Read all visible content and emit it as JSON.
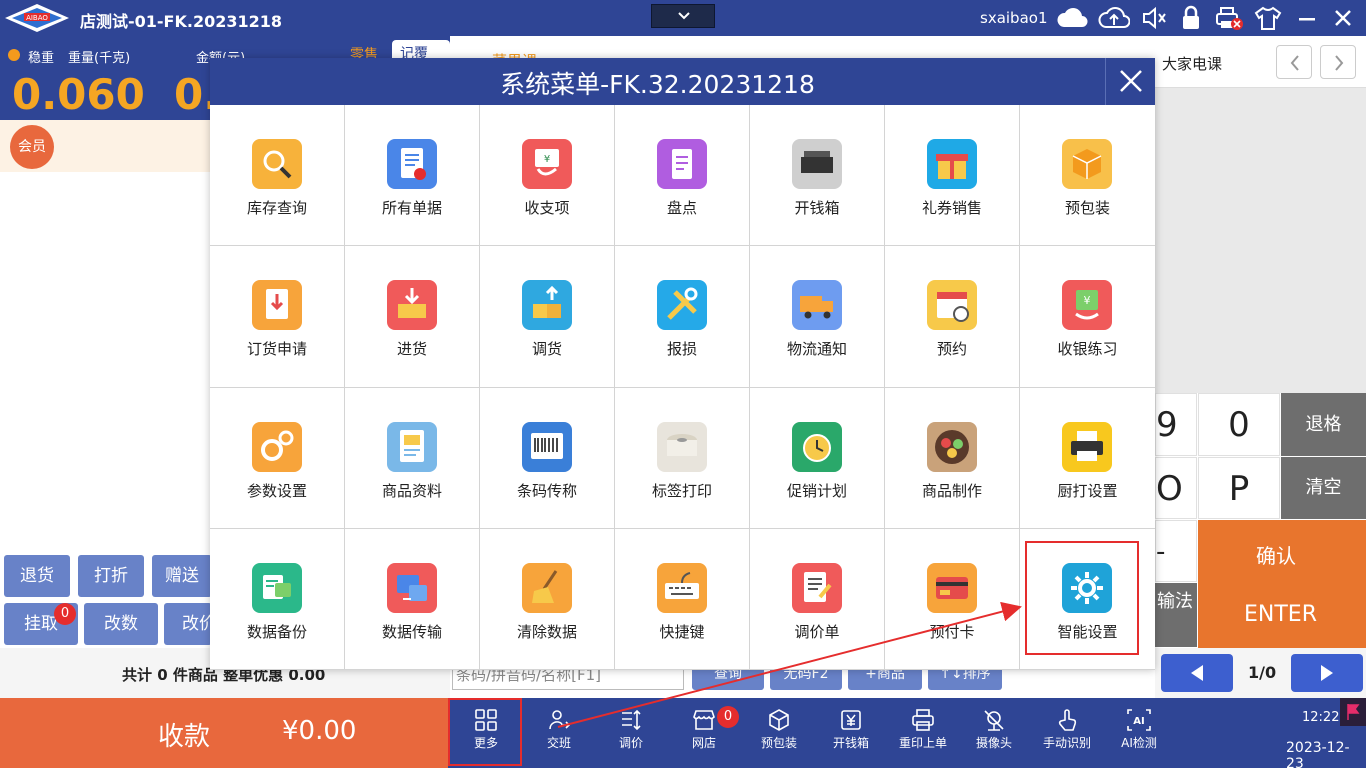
{
  "window": {
    "title": "店测试-01-FK.20231218",
    "logo_text": "AIBAO",
    "user": "sxaibao1"
  },
  "scale": {
    "stable_label": "稳重",
    "weight_label": "重量(千克)",
    "amount_label": "金额(元)",
    "weight_value": "0.060",
    "amount_value": "0.",
    "tabs": {
      "retail": "零售",
      "recall": "记覆"
    }
  },
  "member": {
    "label": "会员"
  },
  "actions": {
    "return": "退货",
    "discount": "打折",
    "gift": "赠送",
    "hold": "挂取",
    "hold_badge": "0",
    "change_qty": "改数",
    "change_price": "改价"
  },
  "summary": {
    "text": "共计 0 件商品 整单优惠 0.00"
  },
  "pay": {
    "label": "收款",
    "amount": "¥0.00"
  },
  "categories": {
    "partial_tab": "大家电课",
    "retail_partial": "菜果课"
  },
  "search": {
    "placeholder": "条码/拼音码/名称[F1]",
    "buttons": [
      "查询",
      "无码F2",
      "+商品",
      "↑↓排序"
    ]
  },
  "keypad": {
    "k9": "9",
    "k0": "0",
    "backspace": "退格",
    "kO": "O",
    "kP": "P",
    "clear": "清空",
    "dash": "-",
    "ime": "输法",
    "confirm": "确认",
    "enter": "ENTER"
  },
  "pager": {
    "text": "1/0"
  },
  "bottom_toolbar": [
    {
      "label": "更多",
      "icon": "grid-icon"
    },
    {
      "label": "交班",
      "icon": "user-switch-icon"
    },
    {
      "label": "调价",
      "icon": "sort-icon"
    },
    {
      "label": "网店",
      "icon": "store-icon",
      "badge": "0"
    },
    {
      "label": "预包装",
      "icon": "box-icon"
    },
    {
      "label": "开钱箱",
      "icon": "cashbox-icon"
    },
    {
      "label": "重印上单",
      "icon": "printer-icon"
    },
    {
      "label": "摄像头",
      "icon": "camera-off-icon"
    },
    {
      "label": "手动识别",
      "icon": "hand-pointer-icon"
    },
    {
      "label": "AI检测",
      "icon": "ai-icon"
    }
  ],
  "clock": {
    "time": "12:22",
    "date": "2023-12-23"
  },
  "modal": {
    "title": "系统菜单-FK.32.20231218",
    "items": [
      {
        "label": "库存查询",
        "icon": "inventory-search-icon",
        "color": "#f7b23b"
      },
      {
        "label": "所有单据",
        "icon": "documents-icon",
        "color": "#4a86e8"
      },
      {
        "label": "收支项",
        "icon": "income-expense-icon",
        "color": "#f05a5a"
      },
      {
        "label": "盘点",
        "icon": "stocktake-icon",
        "color": "#b05de0"
      },
      {
        "label": "开钱箱",
        "icon": "cash-drawer-icon",
        "color": "#cfcfcf"
      },
      {
        "label": "礼券销售",
        "icon": "gift-icon",
        "color": "#1fa9e6"
      },
      {
        "label": "预包装",
        "icon": "package-icon",
        "color": "#f8c04a"
      },
      {
        "label": "订货申请",
        "icon": "order-request-icon",
        "color": "#f7a43b"
      },
      {
        "label": "进货",
        "icon": "purchase-icon",
        "color": "#f05a5a"
      },
      {
        "label": "调货",
        "icon": "transfer-icon",
        "color": "#2fa8e0"
      },
      {
        "label": "报损",
        "icon": "tools-icon",
        "color": "#25a9e8"
      },
      {
        "label": "物流通知",
        "icon": "truck-icon",
        "color": "#6e9cf0"
      },
      {
        "label": "预约",
        "icon": "calendar-icon",
        "color": "#f7c94a"
      },
      {
        "label": "收银练习",
        "icon": "cash-practice-icon",
        "color": "#f05a5a"
      },
      {
        "label": "参数设置",
        "icon": "gears-icon",
        "color": "#f7a43b"
      },
      {
        "label": "商品资料",
        "icon": "product-file-icon",
        "color": "#7ab8e8"
      },
      {
        "label": "条码传称",
        "icon": "barcode-icon",
        "color": "#3a7fd8"
      },
      {
        "label": "标签打印",
        "icon": "label-roll-icon",
        "color": "#e8e4dc"
      },
      {
        "label": "促销计划",
        "icon": "alarm-clock-icon",
        "color": "#2aa86a"
      },
      {
        "label": "商品制作",
        "icon": "food-bowl-icon",
        "color": "#c9a27a"
      },
      {
        "label": "厨打设置",
        "icon": "kitchen-printer-icon",
        "color": "#f8c81e"
      },
      {
        "label": "数据备份",
        "icon": "backup-icon",
        "color": "#2bb88a"
      },
      {
        "label": "数据传输",
        "icon": "data-transfer-icon",
        "color": "#f05a5a"
      },
      {
        "label": "清除数据",
        "icon": "broom-icon",
        "color": "#f7a43b"
      },
      {
        "label": "快捷键",
        "icon": "keyboard-icon",
        "color": "#f7a43b"
      },
      {
        "label": "调价单",
        "icon": "price-sheet-icon",
        "color": "#f05a5a"
      },
      {
        "label": "预付卡",
        "icon": "prepaid-card-icon",
        "color": "#f7a43b"
      },
      {
        "label": "智能设置",
        "icon": "smart-settings-icon",
        "color": "#1fa3d8"
      }
    ]
  },
  "colors": {
    "primary": "#2f4595",
    "accent_orange": "#e8683d",
    "highlight_red": "#e52d2d"
  }
}
